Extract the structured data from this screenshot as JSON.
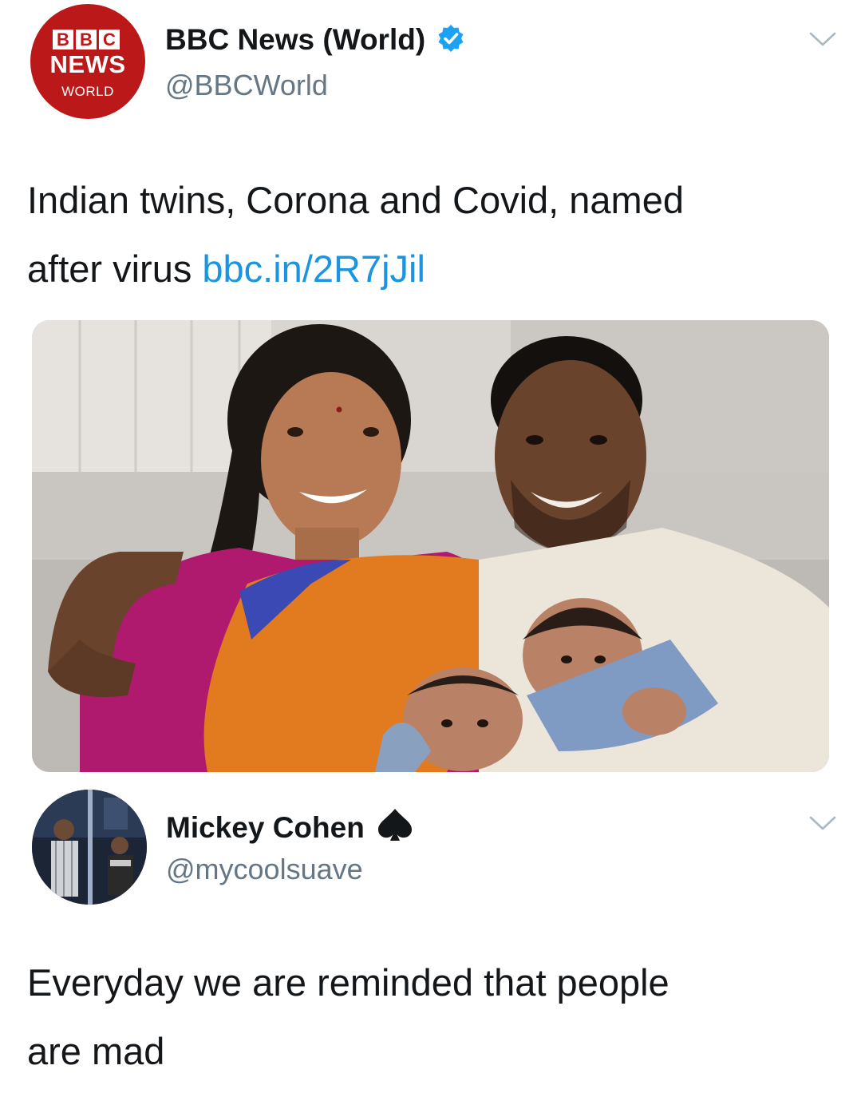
{
  "tweet1": {
    "avatar": {
      "logo_letters": [
        "B",
        "B",
        "C"
      ],
      "logo_news": "NEWS",
      "logo_world": "WORLD"
    },
    "display_name": "BBC News (World)",
    "verified": true,
    "handle": "@BBCWorld",
    "text_line1": "Indian twins, Corona and Covid, named",
    "text_line2_plain": "after virus ",
    "link_text": "bbc.in/2R7jJil",
    "icons": {
      "verified": "verified-badge-icon",
      "menu": "chevron-down-icon"
    },
    "colors": {
      "bbc_red": "#bb1919",
      "link": "#1b95e0",
      "verified": "#1da1f2"
    }
  },
  "tweet2": {
    "display_name": "Mickey Cohen",
    "name_emoji": "♠",
    "handle": "@mycoolsuave",
    "text_line1": "Everyday we are reminded that people",
    "text_line2": "are mad",
    "icons": {
      "menu": "chevron-down-icon"
    }
  }
}
